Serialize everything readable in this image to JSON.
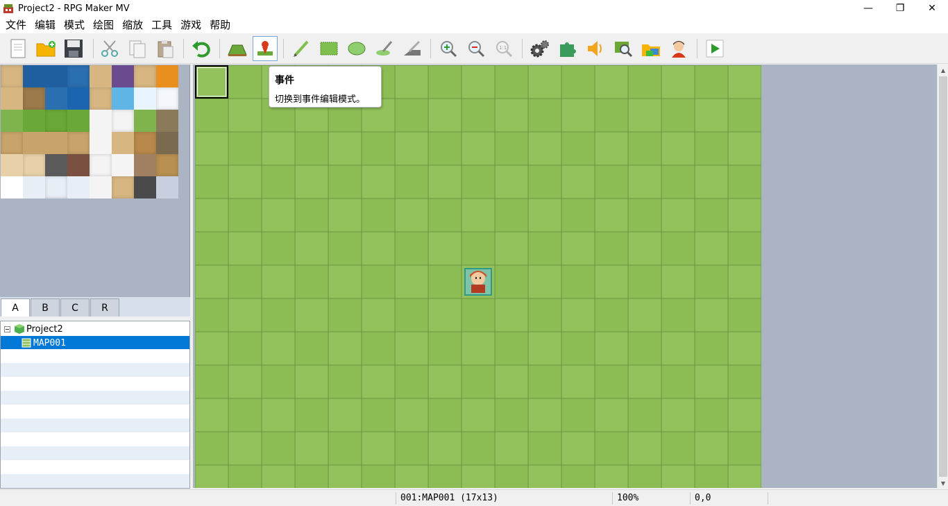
{
  "window": {
    "title": "Project2 - RPG Maker MV",
    "minimize": "—",
    "restore": "❐",
    "close": "✕"
  },
  "menu": [
    "文件",
    "编辑",
    "模式",
    "绘图",
    "缩放",
    "工具",
    "游戏",
    "帮助"
  ],
  "toolbar": {
    "buttons": [
      {
        "name": "new-project",
        "icon": "new-document-icon"
      },
      {
        "name": "open-project",
        "icon": "folder-icon"
      },
      {
        "name": "save-project",
        "icon": "save-icon"
      },
      {
        "name": "cut",
        "icon": "scissors-icon"
      },
      {
        "name": "copy",
        "icon": "copy-icon"
      },
      {
        "name": "paste",
        "icon": "paste-icon"
      },
      {
        "name": "undo",
        "icon": "undo-icon"
      },
      {
        "name": "map-mode",
        "icon": "map-mode-icon"
      },
      {
        "name": "event-mode",
        "icon": "event-mode-icon",
        "active": true
      },
      {
        "name": "pencil",
        "icon": "pencil-icon"
      },
      {
        "name": "rectangle",
        "icon": "rectangle-icon"
      },
      {
        "name": "ellipse",
        "icon": "ellipse-icon"
      },
      {
        "name": "flood-fill",
        "icon": "fill-icon"
      },
      {
        "name": "shadow-pen",
        "icon": "shadow-pen-icon"
      },
      {
        "name": "zoom-in",
        "icon": "zoom-in-icon"
      },
      {
        "name": "zoom-out",
        "icon": "zoom-out-icon"
      },
      {
        "name": "actual-size",
        "icon": "zoom-actual-icon"
      },
      {
        "name": "database",
        "icon": "gears-icon"
      },
      {
        "name": "plugin-manager",
        "icon": "puzzle-icon"
      },
      {
        "name": "sound-test",
        "icon": "speaker-icon"
      },
      {
        "name": "event-searcher",
        "icon": "search-events-icon"
      },
      {
        "name": "resource-manager",
        "icon": "resource-folder-icon"
      },
      {
        "name": "character-generator",
        "icon": "character-icon"
      },
      {
        "name": "playtest",
        "icon": "play-icon"
      }
    ]
  },
  "tooltip": {
    "title": "事件",
    "body": "切换到事件编辑模式。"
  },
  "tabs": [
    "A",
    "B",
    "C",
    "R"
  ],
  "active_tab": "A",
  "map_tree": {
    "project": "Project2",
    "maps": [
      "MAP001"
    ]
  },
  "status": {
    "map": "001:MAP001 (17x13)",
    "zoom": "100%",
    "coords": "0,0"
  },
  "colors": {
    "grass": "#8fbf58",
    "grid": "#6e9444",
    "selection": "#0078d7",
    "background": "#abb4c2"
  }
}
